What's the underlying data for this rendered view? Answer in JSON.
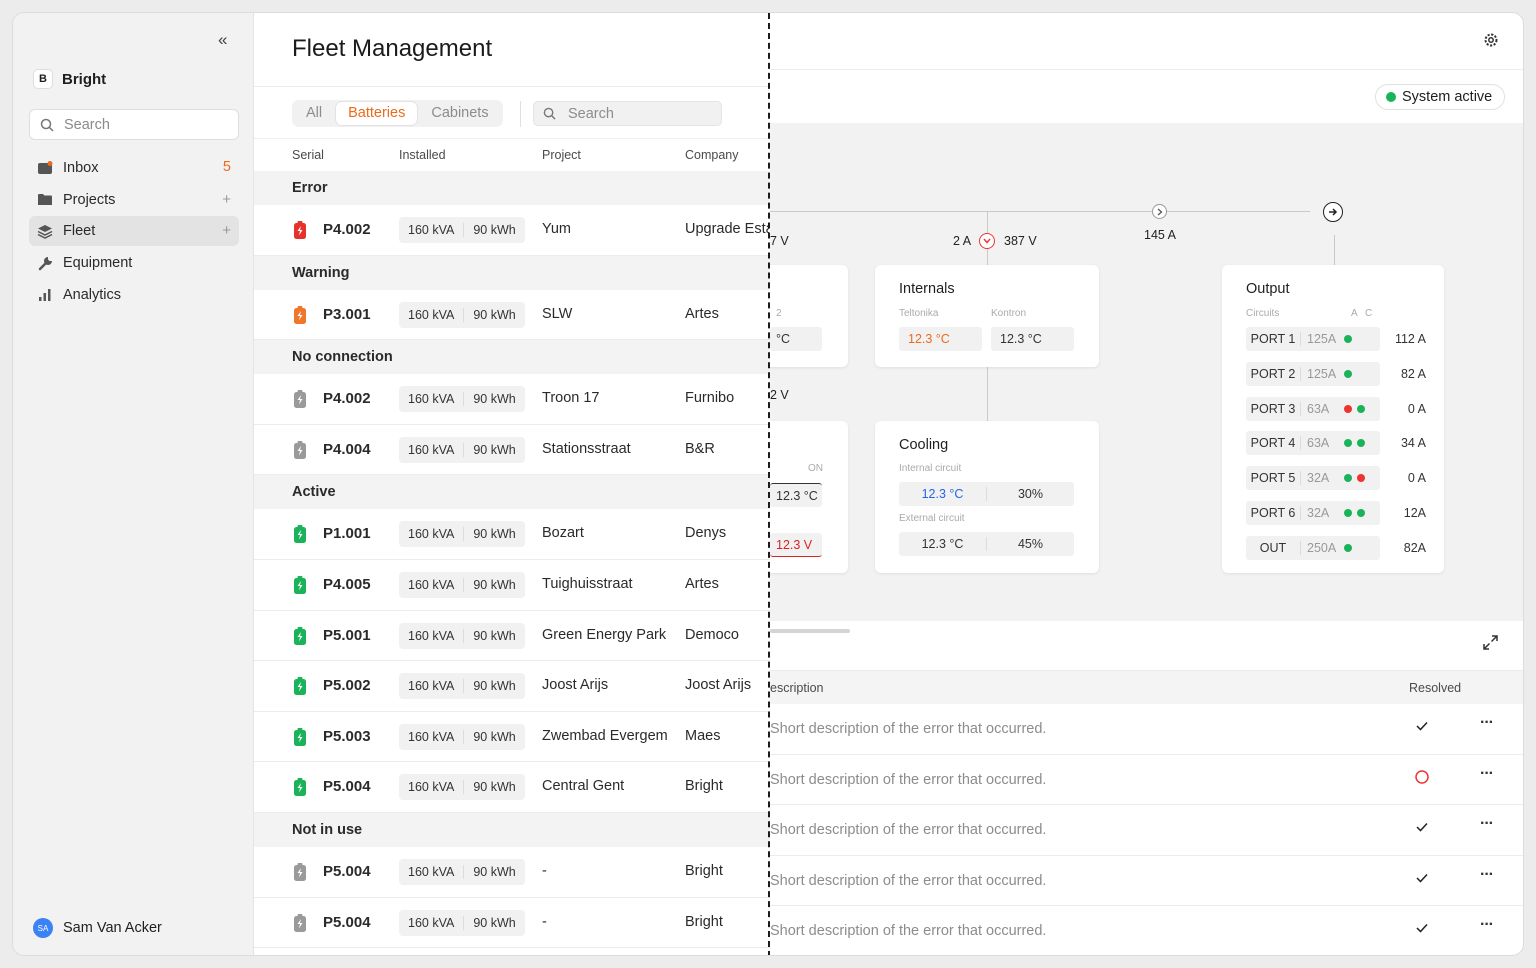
{
  "sidebar": {
    "collapse_icon": "double-chevron-left-icon",
    "brand": {
      "logo": "B",
      "name": "Bright"
    },
    "search_placeholder": "Search",
    "items": [
      {
        "label": "Inbox",
        "icon": "inbox-icon",
        "badge": "5"
      },
      {
        "label": "Projects",
        "icon": "folder-icon",
        "action": "+"
      },
      {
        "label": "Fleet",
        "icon": "layers-icon",
        "action": "+",
        "active": true
      },
      {
        "label": "Equipment",
        "icon": "wrench-icon"
      },
      {
        "label": "Analytics",
        "icon": "bar-chart-icon"
      }
    ],
    "user": {
      "initials": "SA",
      "name": "Sam Van Acker"
    }
  },
  "main": {
    "title": "Fleet Management",
    "tabs": [
      {
        "label": "All"
      },
      {
        "label": "Batteries",
        "active": true
      },
      {
        "label": "Cabinets"
      }
    ],
    "search_placeholder": "Search",
    "columns": {
      "serial": "Serial",
      "installed": "Installed",
      "project": "Project",
      "company": "Company"
    },
    "groups": [
      {
        "name": "Error",
        "rows": [
          {
            "serial": "P4.002",
            "kva": "160 kVA",
            "kwh": "90 kWh",
            "project": "Yum",
            "company": "Upgrade Estate",
            "status": "error"
          }
        ]
      },
      {
        "name": "Warning",
        "rows": [
          {
            "serial": "P3.001",
            "kva": "160 kVA",
            "kwh": "90 kWh",
            "project": "SLW",
            "company": "Artes",
            "status": "warning"
          }
        ]
      },
      {
        "name": "No connection",
        "rows": [
          {
            "serial": "P4.002",
            "kva": "160 kVA",
            "kwh": "90 kWh",
            "project": "Troon 17",
            "company": "Furnibo",
            "status": "offline"
          },
          {
            "serial": "P4.004",
            "kva": "160 kVA",
            "kwh": "90 kWh",
            "project": "Stationsstraat",
            "company": "B&R",
            "status": "offline"
          }
        ]
      },
      {
        "name": "Active",
        "rows": [
          {
            "serial": "P1.001",
            "kva": "160 kVA",
            "kwh": "90 kWh",
            "project": "Bozart",
            "company": "Denys",
            "status": "active"
          },
          {
            "serial": "P4.005",
            "kva": "160 kVA",
            "kwh": "90 kWh",
            "project": "Tuighuisstraat",
            "company": "Artes",
            "status": "active"
          },
          {
            "serial": "P5.001",
            "kva": "160 kVA",
            "kwh": "90 kWh",
            "project": "Green Energy Park",
            "company": "Democo",
            "status": "active"
          },
          {
            "serial": "P5.002",
            "kva": "160 kVA",
            "kwh": "90 kWh",
            "project": "Joost Arijs",
            "company": "Joost Arijs",
            "status": "active"
          },
          {
            "serial": "P5.003",
            "kva": "160 kVA",
            "kwh": "90 kWh",
            "project": "Zwembad Evergem",
            "company": "Maes",
            "status": "active"
          },
          {
            "serial": "P5.004",
            "kva": "160 kVA",
            "kwh": "90 kWh",
            "project": "Central Gent",
            "company": "Bright",
            "status": "active"
          }
        ]
      },
      {
        "name": "Not in use",
        "rows": [
          {
            "serial": "P5.004",
            "kva": "160 kVA",
            "kwh": "90 kWh",
            "project": "-",
            "company": "Bright",
            "status": "offline"
          },
          {
            "serial": "P5.004",
            "kva": "160 kVA",
            "kwh": "90 kWh",
            "project": "-",
            "company": "Bright",
            "status": "offline"
          }
        ]
      }
    ]
  },
  "detail": {
    "status_label": "System active",
    "colors": {
      "error": "#e5322d",
      "warning": "#f0762a",
      "active": "#1bb35a",
      "offline": "#9a9a9a",
      "accent": "#ee6a1a"
    },
    "diagram": {
      "top_labels": {
        "left_v": "7 V",
        "current_in": "2 A",
        "voltage": "387 V",
        "current_out": "145 A",
        "mid_v": "2 V"
      },
      "left_partial": {
        "sub": "2",
        "temp": "°C",
        "on": "ON",
        "val1": "12.3 °C",
        "val2": "12.3 V"
      },
      "internals": {
        "title": "Internals",
        "sub1": "Teltonika",
        "sub2": "Kontron",
        "val1": "12.3 °C",
        "val2": "12.3 °C"
      },
      "cooling": {
        "title": "Cooling",
        "internal_label": "Internal circuit",
        "internal_temp": "12.3 °C",
        "internal_pct": "30%",
        "external_label": "External circuit",
        "external_temp": "12.3 °C",
        "external_pct": "45%"
      },
      "output": {
        "title": "Output",
        "circuits_label": "Circuits",
        "a_label": "A",
        "c_label": "C",
        "ports": [
          {
            "name": "PORT 1",
            "rating": "125A",
            "a": "green",
            "c": "",
            "value": "112 A"
          },
          {
            "name": "PORT 2",
            "rating": "125A",
            "a": "green",
            "c": "",
            "value": "82 A"
          },
          {
            "name": "PORT 3",
            "rating": "63A",
            "a": "red",
            "c": "green",
            "value": "0 A"
          },
          {
            "name": "PORT 4",
            "rating": "63A",
            "a": "green",
            "c": "green",
            "value": "34 A"
          },
          {
            "name": "PORT 5",
            "rating": "32A",
            "a": "green",
            "c": "red",
            "value": "0 A"
          },
          {
            "name": "PORT 6",
            "rating": "32A",
            "a": "green",
            "c": "green",
            "value": "12A"
          },
          {
            "name": "OUT",
            "rating": "250A",
            "a": "green",
            "c": "",
            "value": "82A"
          }
        ]
      }
    },
    "errors": {
      "col_description": "escription",
      "col_resolved": "Resolved",
      "rows": [
        {
          "description": "Short description of the error that occurred.",
          "resolved": true
        },
        {
          "description": "Short description of the error that occurred.",
          "resolved": false
        },
        {
          "description": "Short description of the error that occurred.",
          "resolved": true
        },
        {
          "description": "Short description of the error that occurred.",
          "resolved": true
        },
        {
          "description": "Short description of the error that occurred.",
          "resolved": true
        }
      ]
    }
  }
}
